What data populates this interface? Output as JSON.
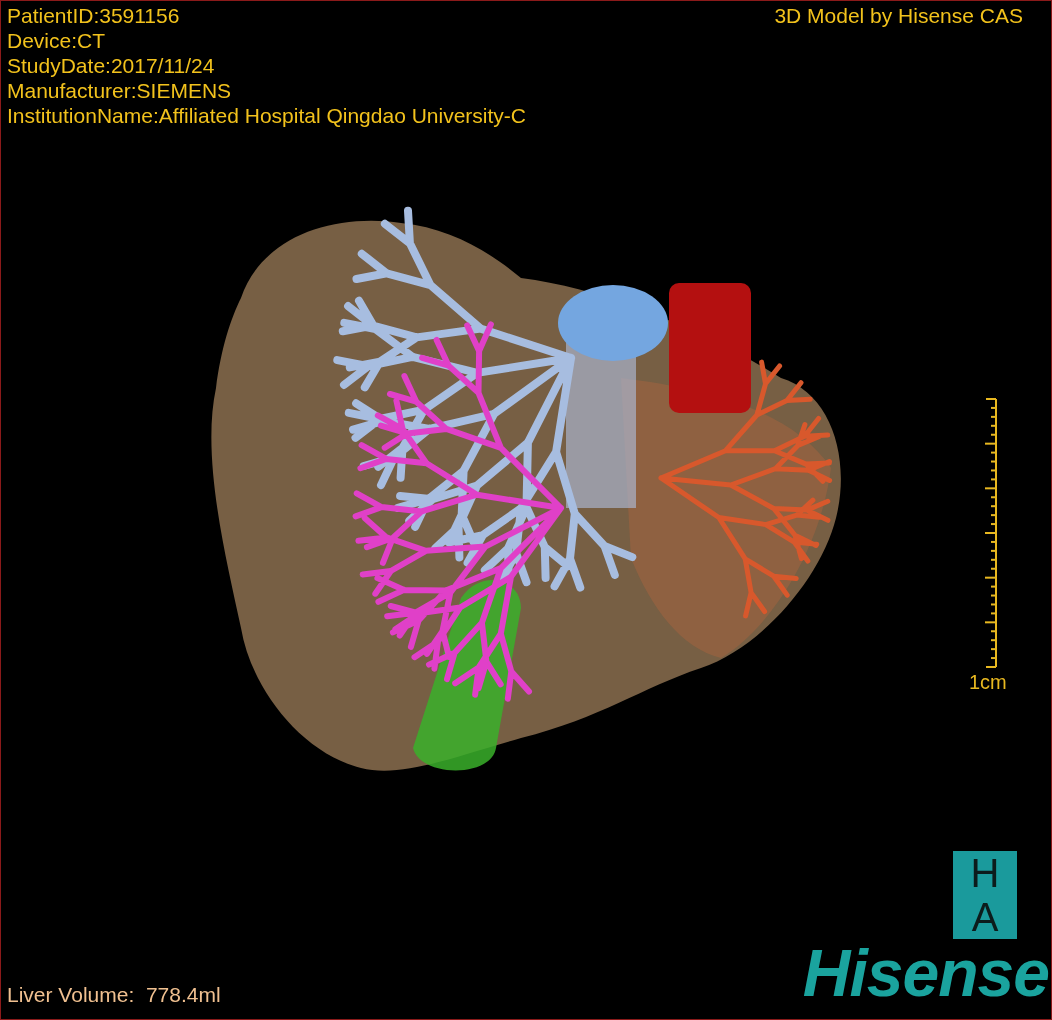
{
  "info_lines": [
    "PatientID:3591156",
    "Device:CT",
    "StudyDate:2017/11/24",
    "Manufacturer:SIEMENS",
    "InstitutionName:Affiliated Hospital Qingdao University-C"
  ],
  "title": "3D Model by Hisense CAS",
  "scale_bar": {
    "label": "1cm"
  },
  "liver_volume": "Liver Volume:  778.4ml",
  "logo": {
    "badge_letters": [
      "H",
      "A"
    ],
    "wordmark": "Hisense"
  }
}
